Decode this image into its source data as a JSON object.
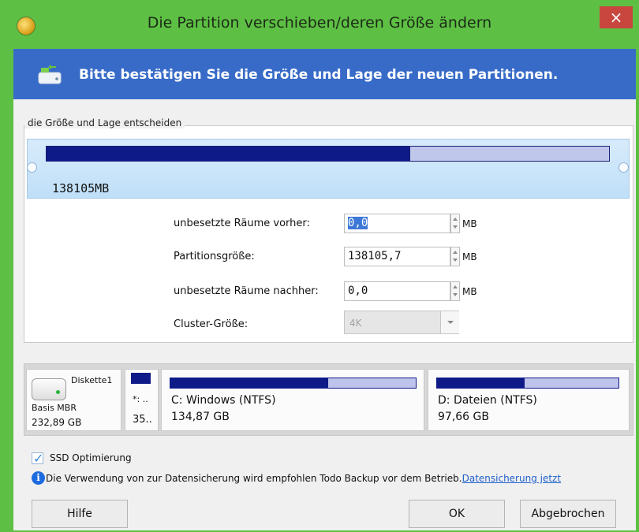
{
  "window": {
    "title": "Die Partition verschieben/deren Größe ändern",
    "close": "×"
  },
  "banner": {
    "text": "Bitte bestätigen Sie die Größe und Lage der neuen Partitionen."
  },
  "section": {
    "group_label": "die Größe und Lage entscheiden",
    "partition_size_display": "138105MB",
    "fields": {
      "before_label": "unbesetzte Räume vorher:",
      "before_value": "0,0",
      "size_label": "Partitionsgröße:",
      "size_value": "138105,7",
      "after_label": "unbesetzte Räume nachher:",
      "after_value": "0,0",
      "unit": "MB",
      "cluster_label": "Cluster-Größe:",
      "cluster_value": "4K"
    }
  },
  "disk": {
    "name": "Diskette1",
    "type": "Basis MBR",
    "size": "232,89 GB",
    "small_part_top": "*: ..",
    "small_part_bottom": "35..",
    "c_name": "C: Windows (NTFS)",
    "c_size": "134,87 GB",
    "d_name": "D: Dateien (NTFS)",
    "d_size": "97,66 GB"
  },
  "options": {
    "ssd": "SSD Optimierung",
    "info": "Die Verwendung von zur Datensicherung wird empfohlen Todo Backup vor dem Betrieb.",
    "link": "Datensicherung jetzt"
  },
  "buttons": {
    "help": "Hilfe",
    "ok": "OK",
    "cancel": "Abgebrochen"
  },
  "colors": {
    "title_bar": "#5dc044",
    "banner": "#386bc8",
    "partition_fill": "#0f1a89",
    "close": "#c8463e"
  }
}
